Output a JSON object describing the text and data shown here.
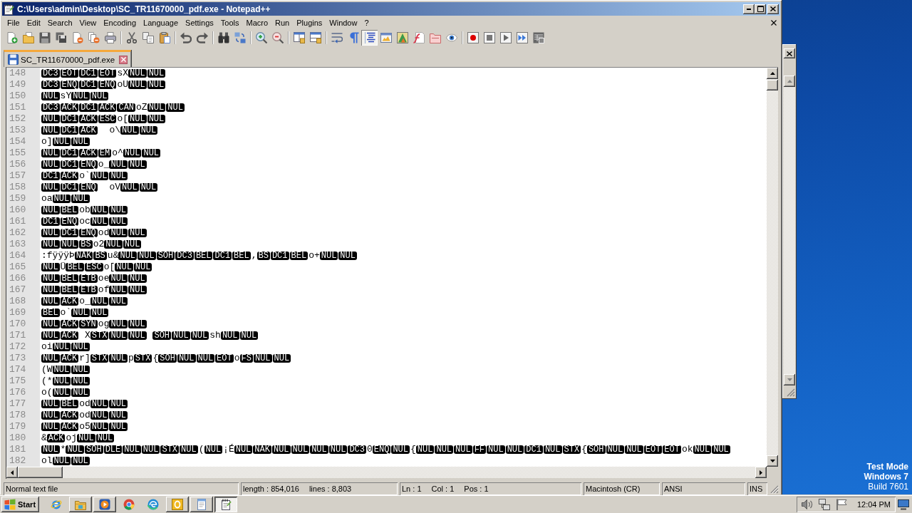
{
  "window": {
    "title": "C:\\Users\\admin\\Desktop\\SC_TR11670000_pdf.exe - Notepad++"
  },
  "menu": [
    "File",
    "Edit",
    "Search",
    "View",
    "Encoding",
    "Language",
    "Settings",
    "Tools",
    "Macro",
    "Run",
    "Plugins",
    "Window",
    "?"
  ],
  "toolbar": {
    "buttons": [
      {
        "pressed": false
      },
      {
        "pressed": false
      },
      {
        "pressed": false
      },
      {
        "pressed": false
      },
      {
        "pressed": false
      },
      {
        "pressed": false
      },
      {
        "pressed": false
      },
      {
        "pressed": false
      },
      {
        "pressed": false
      },
      {
        "pressed": false
      },
      {
        "pressed": false
      },
      {
        "pressed": false
      },
      {
        "pressed": false
      },
      {
        "pressed": false
      },
      {
        "pressed": false
      },
      {
        "pressed": false
      },
      {
        "pressed": false
      },
      {
        "pressed": false
      },
      {
        "pressed": false
      },
      {
        "pressed": false
      },
      {
        "pressed": true
      },
      {
        "pressed": false
      },
      {
        "pressed": false
      },
      {
        "pressed": false
      },
      {
        "pressed": false
      },
      {
        "pressed": false
      },
      {
        "pressed": false
      },
      {
        "pressed": false
      },
      {
        "pressed": false
      },
      {
        "pressed": false
      },
      {
        "pressed": false
      }
    ]
  },
  "tabs": [
    {
      "label": "SC_TR11670000_pdf.exe",
      "selected": true
    }
  ],
  "editor": {
    "lines": [
      {
        "number": "148",
        "parts": [
          {
            "kind": "control",
            "text": "DC3"
          },
          {
            "kind": "control",
            "text": "EOT"
          },
          {
            "kind": "control",
            "text": "DC1"
          },
          {
            "kind": "control",
            "text": "EOT"
          },
          {
            "kind": "text",
            "text": "sX"
          },
          {
            "kind": "control",
            "text": "NUL"
          },
          {
            "kind": "control",
            "text": "NUL"
          }
        ]
      },
      {
        "number": "149",
        "parts": [
          {
            "kind": "control",
            "text": "DC3"
          },
          {
            "kind": "control",
            "text": "ENQ"
          },
          {
            "kind": "control",
            "text": "DC1"
          },
          {
            "kind": "control",
            "text": "ENQ"
          },
          {
            "kind": "text",
            "text": "oU"
          },
          {
            "kind": "control",
            "text": "NUL"
          },
          {
            "kind": "control",
            "text": "NUL"
          }
        ]
      },
      {
        "number": "150",
        "parts": [
          {
            "kind": "control",
            "text": "NUL"
          },
          {
            "kind": "text",
            "text": "sY"
          },
          {
            "kind": "control",
            "text": "NUL"
          },
          {
            "kind": "control",
            "text": "NUL"
          }
        ]
      },
      {
        "number": "151",
        "parts": [
          {
            "kind": "control",
            "text": "DC3"
          },
          {
            "kind": "control",
            "text": "ACK"
          },
          {
            "kind": "control",
            "text": "DC1"
          },
          {
            "kind": "control",
            "text": "ACK"
          },
          {
            "kind": "control",
            "text": "CAN"
          },
          {
            "kind": "text",
            "text": "oZ"
          },
          {
            "kind": "control",
            "text": "NUL"
          },
          {
            "kind": "control",
            "text": "NUL"
          }
        ]
      },
      {
        "number": "152",
        "parts": [
          {
            "kind": "control",
            "text": "NUL"
          },
          {
            "kind": "control",
            "text": "DC1"
          },
          {
            "kind": "control",
            "text": "ACK"
          },
          {
            "kind": "control",
            "text": "ESC"
          },
          {
            "kind": "text",
            "text": "o["
          },
          {
            "kind": "control",
            "text": "NUL"
          },
          {
            "kind": "control",
            "text": "NUL"
          }
        ]
      },
      {
        "number": "153",
        "parts": [
          {
            "kind": "control",
            "text": "NUL"
          },
          {
            "kind": "control",
            "text": "DC1"
          },
          {
            "kind": "control",
            "text": "ACK"
          },
          {
            "kind": "space"
          },
          {
            "kind": "space"
          },
          {
            "kind": "text",
            "text": "o\\"
          },
          {
            "kind": "control",
            "text": "NUL"
          },
          {
            "kind": "control",
            "text": "NUL"
          }
        ]
      },
      {
        "number": "154",
        "parts": [
          {
            "kind": "text",
            "text": "o]"
          },
          {
            "kind": "control",
            "text": "NUL"
          },
          {
            "kind": "control",
            "text": "NUL"
          }
        ]
      },
      {
        "number": "155",
        "parts": [
          {
            "kind": "control",
            "text": "NUL"
          },
          {
            "kind": "control",
            "text": "DC1"
          },
          {
            "kind": "control",
            "text": "ACK"
          },
          {
            "kind": "control",
            "text": "EM"
          },
          {
            "kind": "text",
            "text": "o^"
          },
          {
            "kind": "control",
            "text": "NUL"
          },
          {
            "kind": "control",
            "text": "NUL"
          }
        ]
      },
      {
        "number": "156",
        "parts": [
          {
            "kind": "control",
            "text": "NUL"
          },
          {
            "kind": "control",
            "text": "DC1"
          },
          {
            "kind": "control",
            "text": "ENQ"
          },
          {
            "kind": "text",
            "text": "o_"
          },
          {
            "kind": "control",
            "text": "NUL"
          },
          {
            "kind": "control",
            "text": "NUL"
          }
        ]
      },
      {
        "number": "157",
        "parts": [
          {
            "kind": "control",
            "text": "DC1"
          },
          {
            "kind": "control",
            "text": "ACK"
          },
          {
            "kind": "text",
            "text": "o`"
          },
          {
            "kind": "control",
            "text": "NUL"
          },
          {
            "kind": "control",
            "text": "NUL"
          }
        ]
      },
      {
        "number": "158",
        "parts": [
          {
            "kind": "control",
            "text": "NUL"
          },
          {
            "kind": "control",
            "text": "DC1"
          },
          {
            "kind": "control",
            "text": "ENQ"
          },
          {
            "kind": "space"
          },
          {
            "kind": "space"
          },
          {
            "kind": "text",
            "text": "oV"
          },
          {
            "kind": "control",
            "text": "NUL"
          },
          {
            "kind": "control",
            "text": "NUL"
          }
        ]
      },
      {
        "number": "159",
        "parts": [
          {
            "kind": "text",
            "text": "oa"
          },
          {
            "kind": "control",
            "text": "NUL"
          },
          {
            "kind": "control",
            "text": "NUL"
          }
        ]
      },
      {
        "number": "160",
        "parts": [
          {
            "kind": "control",
            "text": "NUL"
          },
          {
            "kind": "control",
            "text": "BEL"
          },
          {
            "kind": "text",
            "text": "ob"
          },
          {
            "kind": "control",
            "text": "NUL"
          },
          {
            "kind": "control",
            "text": "NUL"
          }
        ]
      },
      {
        "number": "161",
        "parts": [
          {
            "kind": "control",
            "text": "DC1"
          },
          {
            "kind": "control",
            "text": "ENQ"
          },
          {
            "kind": "text",
            "text": "oc"
          },
          {
            "kind": "control",
            "text": "NUL"
          },
          {
            "kind": "control",
            "text": "NUL"
          }
        ]
      },
      {
        "number": "162",
        "parts": [
          {
            "kind": "control",
            "text": "NUL"
          },
          {
            "kind": "control",
            "text": "DC1"
          },
          {
            "kind": "control",
            "text": "ENQ"
          },
          {
            "kind": "text",
            "text": "od"
          },
          {
            "kind": "control",
            "text": "NUL"
          },
          {
            "kind": "control",
            "text": "NUL"
          }
        ]
      },
      {
        "number": "163",
        "parts": [
          {
            "kind": "control",
            "text": "NUL"
          },
          {
            "kind": "control",
            "text": "NUL"
          },
          {
            "kind": "control",
            "text": "BS"
          },
          {
            "kind": "text",
            "text": "o2"
          },
          {
            "kind": "control",
            "text": "NUL"
          },
          {
            "kind": "control",
            "text": "NUL"
          }
        ]
      },
      {
        "number": "164",
        "parts": [
          {
            "kind": "text",
            "text": ":fÿÿÿÞ"
          },
          {
            "kind": "control",
            "text": "NAK"
          },
          {
            "kind": "control",
            "text": "BS"
          },
          {
            "kind": "text",
            "text": "u&"
          },
          {
            "kind": "control",
            "text": "NUL"
          },
          {
            "kind": "control",
            "text": "NUL"
          },
          {
            "kind": "control",
            "text": "SOH"
          },
          {
            "kind": "control",
            "text": "DC3"
          },
          {
            "kind": "control",
            "text": "BEL"
          },
          {
            "kind": "control",
            "text": "DC1"
          },
          {
            "kind": "control",
            "text": "BEL"
          },
          {
            "kind": "text",
            "text": ","
          },
          {
            "kind": "control",
            "text": "BS"
          },
          {
            "kind": "control",
            "text": "DC1"
          },
          {
            "kind": "control",
            "text": "BEL"
          },
          {
            "kind": "text",
            "text": "o+"
          },
          {
            "kind": "control",
            "text": "NUL"
          },
          {
            "kind": "control",
            "text": "NUL"
          }
        ]
      },
      {
        "number": "165",
        "parts": [
          {
            "kind": "control",
            "text": "NUL"
          },
          {
            "kind": "text",
            "text": "Ü"
          },
          {
            "kind": "control",
            "text": "BEL"
          },
          {
            "kind": "control",
            "text": "ESC"
          },
          {
            "kind": "text",
            "text": "o["
          },
          {
            "kind": "control",
            "text": "NUL"
          },
          {
            "kind": "control",
            "text": "NUL"
          }
        ]
      },
      {
        "number": "166",
        "parts": [
          {
            "kind": "control",
            "text": "NUL"
          },
          {
            "kind": "control",
            "text": "BEL"
          },
          {
            "kind": "control",
            "text": "ETB"
          },
          {
            "kind": "text",
            "text": "oe"
          },
          {
            "kind": "control",
            "text": "NUL"
          },
          {
            "kind": "control",
            "text": "NUL"
          }
        ]
      },
      {
        "number": "167",
        "parts": [
          {
            "kind": "control",
            "text": "NUL"
          },
          {
            "kind": "control",
            "text": "BEL"
          },
          {
            "kind": "control",
            "text": "ETB"
          },
          {
            "kind": "text",
            "text": "of"
          },
          {
            "kind": "control",
            "text": "NUL"
          },
          {
            "kind": "control",
            "text": "NUL"
          }
        ]
      },
      {
        "number": "168",
        "parts": [
          {
            "kind": "control",
            "text": "NUL"
          },
          {
            "kind": "control",
            "text": "ACK"
          },
          {
            "kind": "text",
            "text": "o_"
          },
          {
            "kind": "control",
            "text": "NUL"
          },
          {
            "kind": "control",
            "text": "NUL"
          }
        ]
      },
      {
        "number": "169",
        "parts": [
          {
            "kind": "control",
            "text": "BEL"
          },
          {
            "kind": "text",
            "text": "o`"
          },
          {
            "kind": "control",
            "text": "NUL"
          },
          {
            "kind": "control",
            "text": "NUL"
          }
        ]
      },
      {
        "number": "170",
        "parts": [
          {
            "kind": "control",
            "text": "NUL"
          },
          {
            "kind": "control",
            "text": "ACK"
          },
          {
            "kind": "control",
            "text": "SYN"
          },
          {
            "kind": "text",
            "text": "og"
          },
          {
            "kind": "control",
            "text": "NUL"
          },
          {
            "kind": "control",
            "text": "NUL"
          }
        ]
      },
      {
        "number": "171",
        "parts": [
          {
            "kind": "control",
            "text": "NUL"
          },
          {
            "kind": "control",
            "text": "ACK"
          },
          {
            "kind": "space"
          },
          {
            "kind": "text",
            "text": "X"
          },
          {
            "kind": "control",
            "text": "STX"
          },
          {
            "kind": "control",
            "text": "NUL"
          },
          {
            "kind": "control",
            "text": "NUL"
          },
          {
            "kind": "space"
          },
          {
            "kind": "control",
            "text": "SOH"
          },
          {
            "kind": "control",
            "text": "NUL"
          },
          {
            "kind": "control",
            "text": "NUL"
          },
          {
            "kind": "text",
            "text": "sh"
          },
          {
            "kind": "control",
            "text": "NUL"
          },
          {
            "kind": "control",
            "text": "NUL"
          }
        ]
      },
      {
        "number": "172",
        "parts": [
          {
            "kind": "text",
            "text": "oi"
          },
          {
            "kind": "control",
            "text": "NUL"
          },
          {
            "kind": "control",
            "text": "NUL"
          }
        ]
      },
      {
        "number": "173",
        "parts": [
          {
            "kind": "control",
            "text": "NUL"
          },
          {
            "kind": "control",
            "text": "ACK"
          },
          {
            "kind": "text",
            "text": "r]"
          },
          {
            "kind": "control",
            "text": "STX"
          },
          {
            "kind": "control",
            "text": "NUL"
          },
          {
            "kind": "text",
            "text": "p"
          },
          {
            "kind": "control",
            "text": "STX"
          },
          {
            "kind": "text",
            "text": "{"
          },
          {
            "kind": "control",
            "text": "SOH"
          },
          {
            "kind": "control",
            "text": "NUL"
          },
          {
            "kind": "control",
            "text": "NUL"
          },
          {
            "kind": "control",
            "text": "EOT"
          },
          {
            "kind": "text",
            "text": "o"
          },
          {
            "kind": "control",
            "text": "FS"
          },
          {
            "kind": "control",
            "text": "NUL"
          },
          {
            "kind": "control",
            "text": "NUL"
          }
        ]
      },
      {
        "number": "174",
        "parts": [
          {
            "kind": "text",
            "text": "(W"
          },
          {
            "kind": "control",
            "text": "NUL"
          },
          {
            "kind": "control",
            "text": "NUL"
          }
        ]
      },
      {
        "number": "175",
        "parts": [
          {
            "kind": "text",
            "text": "(*"
          },
          {
            "kind": "control",
            "text": "NUL"
          },
          {
            "kind": "control",
            "text": "NUL"
          }
        ]
      },
      {
        "number": "176",
        "parts": [
          {
            "kind": "text",
            "text": "o("
          },
          {
            "kind": "control",
            "text": "NUL"
          },
          {
            "kind": "control",
            "text": "NUL"
          }
        ]
      },
      {
        "number": "177",
        "parts": [
          {
            "kind": "control",
            "text": "NUL"
          },
          {
            "kind": "control",
            "text": "BEL"
          },
          {
            "kind": "text",
            "text": "od"
          },
          {
            "kind": "control",
            "text": "NUL"
          },
          {
            "kind": "control",
            "text": "NUL"
          }
        ]
      },
      {
        "number": "178",
        "parts": [
          {
            "kind": "control",
            "text": "NUL"
          },
          {
            "kind": "control",
            "text": "ACK"
          },
          {
            "kind": "text",
            "text": "od"
          },
          {
            "kind": "control",
            "text": "NUL"
          },
          {
            "kind": "control",
            "text": "NUL"
          }
        ]
      },
      {
        "number": "179",
        "parts": [
          {
            "kind": "control",
            "text": "NUL"
          },
          {
            "kind": "control",
            "text": "ACK"
          },
          {
            "kind": "text",
            "text": "o5"
          },
          {
            "kind": "control",
            "text": "NUL"
          },
          {
            "kind": "control",
            "text": "NUL"
          }
        ]
      },
      {
        "number": "180",
        "parts": [
          {
            "kind": "text",
            "text": "&"
          },
          {
            "kind": "control",
            "text": "ACK"
          },
          {
            "kind": "text",
            "text": "oj"
          },
          {
            "kind": "control",
            "text": "NUL"
          },
          {
            "kind": "control",
            "text": "NUL"
          }
        ]
      },
      {
        "number": "181",
        "parts": [
          {
            "kind": "control",
            "text": "NUL"
          },
          {
            "kind": "text",
            "text": "*"
          },
          {
            "kind": "control",
            "text": "NUL"
          },
          {
            "kind": "control",
            "text": "SOH"
          },
          {
            "kind": "control",
            "text": "DLE"
          },
          {
            "kind": "control",
            "text": "NUL"
          },
          {
            "kind": "control",
            "text": "NUL"
          },
          {
            "kind": "control",
            "text": "STX"
          },
          {
            "kind": "control",
            "text": "NUL"
          },
          {
            "kind": "text",
            "text": "("
          },
          {
            "kind": "control",
            "text": "NUL"
          },
          {
            "kind": "text",
            "text": "¡É"
          },
          {
            "kind": "control",
            "text": "NUL"
          },
          {
            "kind": "control",
            "text": "NAK"
          },
          {
            "kind": "control",
            "text": "NUL"
          },
          {
            "kind": "control",
            "text": "NUL"
          },
          {
            "kind": "control",
            "text": "NUL"
          },
          {
            "kind": "control",
            "text": "NUL"
          },
          {
            "kind": "control",
            "text": "DC3"
          },
          {
            "kind": "text",
            "text": "0"
          },
          {
            "kind": "control",
            "text": "ENQ"
          },
          {
            "kind": "control",
            "text": "NUL"
          },
          {
            "kind": "text",
            "text": "{"
          },
          {
            "kind": "control",
            "text": "NUL"
          },
          {
            "kind": "control",
            "text": "NUL"
          },
          {
            "kind": "control",
            "text": "NUL"
          },
          {
            "kind": "control",
            "text": "FF"
          },
          {
            "kind": "control",
            "text": "NUL"
          },
          {
            "kind": "control",
            "text": "NUL"
          },
          {
            "kind": "control",
            "text": "DC1"
          },
          {
            "kind": "control",
            "text": "NUL"
          },
          {
            "kind": "control",
            "text": "STX"
          },
          {
            "kind": "text",
            "text": "{"
          },
          {
            "kind": "control",
            "text": "SOH"
          },
          {
            "kind": "control",
            "text": "NUL"
          },
          {
            "kind": "control",
            "text": "NUL"
          },
          {
            "kind": "control",
            "text": "EOT"
          },
          {
            "kind": "control",
            "text": "EOT"
          },
          {
            "kind": "text",
            "text": "ok"
          },
          {
            "kind": "control",
            "text": "NUL"
          },
          {
            "kind": "control",
            "text": "NUL"
          }
        ]
      },
      {
        "number": "182",
        "parts": [
          {
            "kind": "text",
            "text": "ol"
          },
          {
            "kind": "control",
            "text": "NUL"
          },
          {
            "kind": "control",
            "text": "NUL"
          }
        ]
      }
    ]
  },
  "status_bar": {
    "file_type": "Normal text file",
    "length": "length : 854,016",
    "lines": "lines : 8,803",
    "line": "Ln : 1",
    "column": "Col : 1",
    "position": "Pos : 1",
    "line_ending": "Macintosh (CR)",
    "encoding": "ANSI",
    "mode": "INS"
  },
  "desktop_notice": {
    "mode": "Test Mode",
    "os": "Windows 7",
    "build": "Build 7601"
  },
  "taskbar": {
    "start": "Start",
    "buttons": [
      {
        "open": false,
        "selected": false
      },
      {
        "open": true,
        "selected": false
      },
      {
        "open": true,
        "selected": false
      },
      {
        "open": false,
        "selected": false
      },
      {
        "open": false,
        "selected": false
      },
      {
        "open": true,
        "selected": false
      },
      {
        "open": true,
        "selected": false
      },
      {
        "open": true,
        "selected": true
      }
    ],
    "clock": "12:04 PM"
  }
}
